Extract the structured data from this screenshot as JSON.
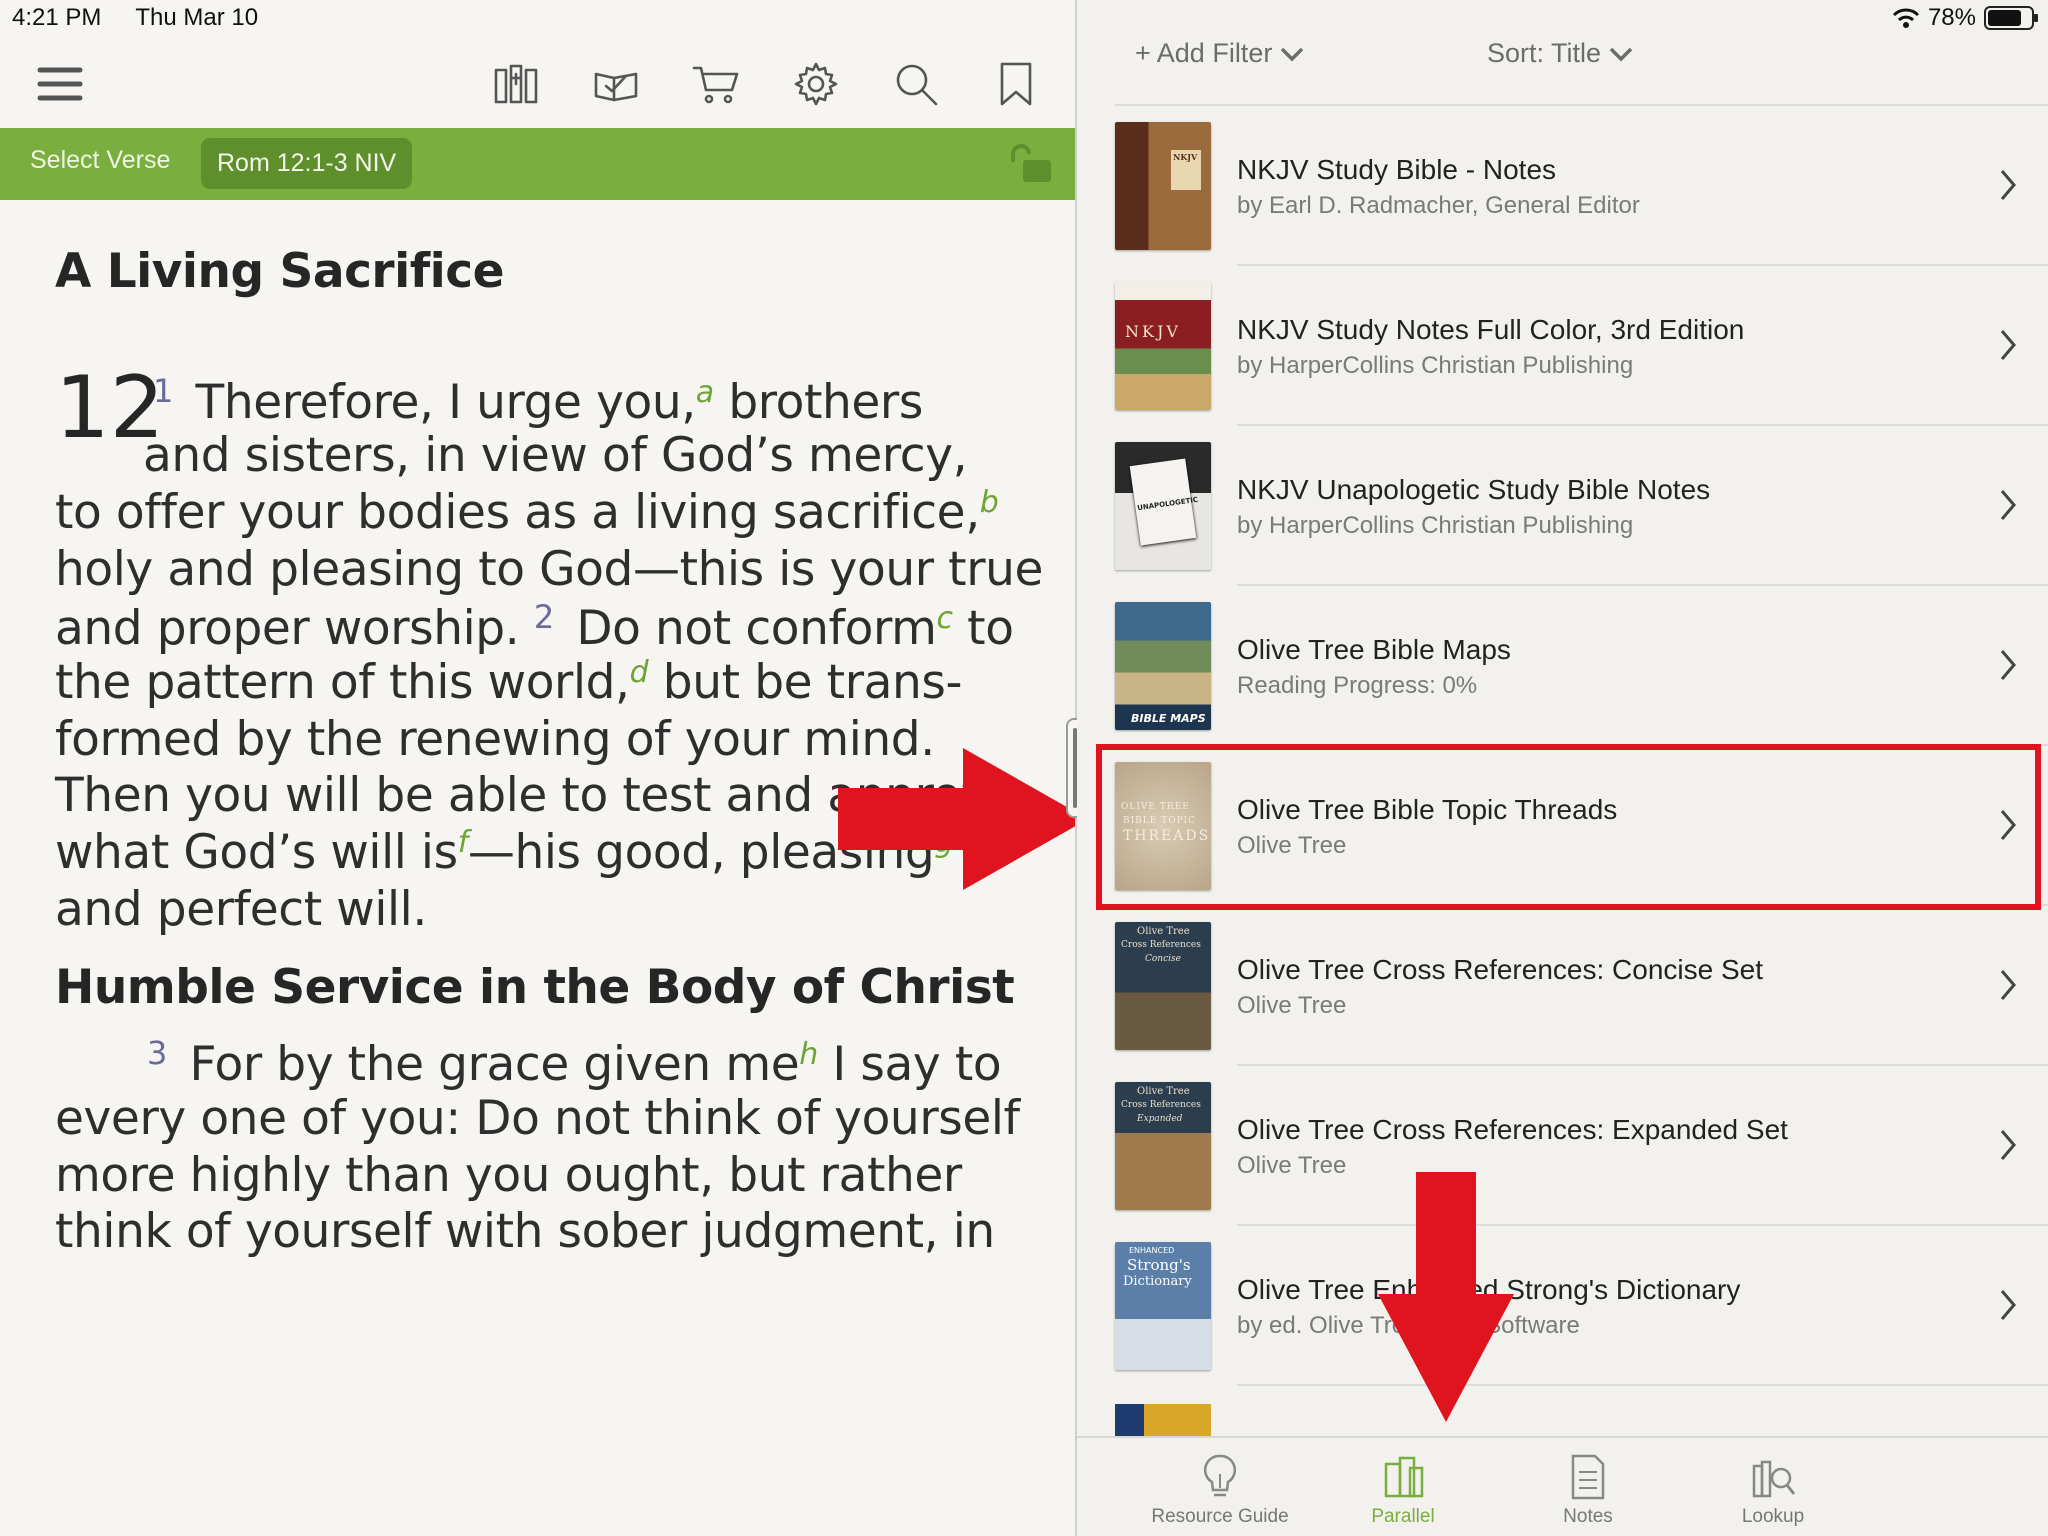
{
  "status": {
    "time": "4:21 PM",
    "date": "Thu Mar 10",
    "battery": "78%",
    "battery_level": 0.78
  },
  "toolbar": {
    "icons": [
      "menu-icon",
      "library-icon",
      "reading-plan-icon",
      "store-cart-icon",
      "settings-gear-icon",
      "search-icon",
      "bookmark-icon"
    ]
  },
  "verse_bar": {
    "select_label": "Select Verse",
    "reference": "Rom 12:1-3 NIV",
    "lock_icon": "unlock-icon",
    "color": "#7aae3f"
  },
  "reader": {
    "heading1": "A Living Sacrifice",
    "chapter": "12",
    "lines": [
      {
        "verse": "1",
        "parts": [
          " Therefore, I urge you,",
          {
            "fn": "a"
          },
          " brothers"
        ]
      },
      {
        "parts": [
          "and sisters, in view of God’s mercy,"
        ]
      },
      {
        "parts": [
          "to offer your bodies as a living sacrifice,",
          {
            "fn": "b"
          }
        ]
      },
      {
        "parts": [
          "holy and pleasing to God—this is your true"
        ]
      },
      {
        "parts": [
          "and proper worship.  "
        ],
        "verse2": "2",
        "parts2": [
          " Do not conform",
          {
            "fn": "c"
          },
          " to"
        ]
      },
      {
        "parts": [
          "the pattern of this world,",
          {
            "fn": "d"
          },
          " but be trans-"
        ]
      },
      {
        "parts": [
          "formed by the renewing of your mind."
        ]
      },
      {
        "parts": [
          "Then you will be able to test and approve"
        ]
      },
      {
        "parts": [
          "what God’s will is",
          {
            "fn": "f"
          },
          "—his good, pleasing",
          {
            "fn": "g"
          }
        ]
      },
      {
        "parts": [
          "and perfect will."
        ]
      }
    ],
    "heading2": "Humble Service in the Body of Christ",
    "lines2": [
      {
        "verse": "3",
        "parts": [
          " For by the grace given me",
          {
            "fn": "h"
          },
          " I say to"
        ]
      },
      {
        "parts": [
          "every one of you: Do not think of yourself"
        ]
      },
      {
        "parts": [
          "more highly than you ought, but rather"
        ]
      },
      {
        "parts": [
          "think of yourself with sober judgment, in"
        ]
      }
    ]
  },
  "filters": {
    "add_filter": "+ Add Filter",
    "sort": "Sort: Title"
  },
  "resources": [
    {
      "title": "NKJV Study Bible - Notes",
      "subtitle": "by Earl D. Radmacher, General Editor",
      "cover": "nkjv-study-bible"
    },
    {
      "title": "NKJV Study Notes Full Color, 3rd Edition",
      "subtitle": "by HarperCollins Christian Publishing",
      "cover": "nkjv-full-color"
    },
    {
      "title": "NKJV Unapologetic Study Bible Notes",
      "subtitle": "by HarperCollins Christian Publishing",
      "cover": "nkjv-unapologetic"
    },
    {
      "title": "Olive Tree Bible Maps",
      "subtitle": "Reading Progress: 0%",
      "cover": "bible-maps"
    },
    {
      "title": "Olive Tree Bible Topic Threads",
      "subtitle": "Olive Tree",
      "cover": "topic-threads"
    },
    {
      "title": "Olive Tree Cross References: Concise Set",
      "subtitle": "Olive Tree",
      "cover": "cross-ref-concise"
    },
    {
      "title": "Olive Tree Cross References: Expanded Set",
      "subtitle": "Olive Tree",
      "cover": "cross-ref-expanded"
    },
    {
      "title": "Olive Tree Enhanced Strong's Dictionary",
      "subtitle": "by ed. Olive Tree Bible Software",
      "cover": "strongs-dictionary"
    }
  ],
  "cover_text": {
    "nkjv_small": "NKJV",
    "nkjv_big": "NKJV",
    "unapologetic": "UNAPOLOGETIC",
    "maps": "BIBLE MAPS",
    "threads_1": "OLIVE TREE",
    "threads_2": "BIBLE TOPIC",
    "threads_3": "THREADS",
    "concise_1": "Olive Tree",
    "concise_2": "Cross References",
    "concise_3": "Concise",
    "expanded_1": "Olive Tree",
    "expanded_2": "Cross References",
    "expanded_3": "Expanded",
    "strongs_1": "ENHANCED",
    "strongs_2": "Strong's",
    "strongs_3": "Dictionary"
  },
  "tabs": [
    {
      "label": "Resource Guide",
      "icon": "lightbulb-icon",
      "active": false
    },
    {
      "label": "Parallel",
      "icon": "parallel-books-icon",
      "active": true
    },
    {
      "label": "Notes",
      "icon": "notes-icon",
      "active": false
    },
    {
      "label": "Lookup",
      "icon": "lookup-icon",
      "active": false
    }
  ],
  "annotations": {
    "highlight_color": "#e0141e",
    "highlighted_item": "Olive Tree Bible Topic Threads"
  }
}
